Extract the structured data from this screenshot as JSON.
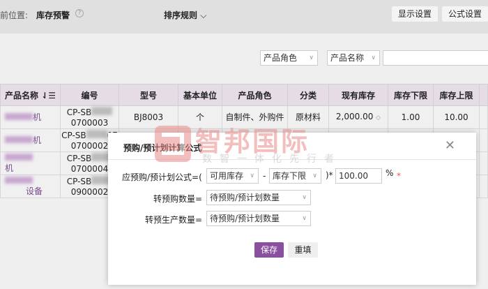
{
  "header": {
    "location_label": "前位置:",
    "location": "库存预警",
    "help_icon": "question-circle-icon",
    "sort_label": "排序规则",
    "display_settings": "显示设置",
    "formula_settings": "公式设置"
  },
  "filters": {
    "role_select": "产品角色",
    "name_select": "产品名称",
    "search_value": ""
  },
  "table": {
    "columns": [
      "产品名称",
      "编号",
      "型号",
      "基本单位",
      "产品角色",
      "分类",
      "现有库存",
      "库存下限",
      "库存上限"
    ],
    "rows": [
      {
        "name_suffix": "机",
        "code_prefix": "CP-SB",
        "code_suffix": "0700003",
        "model": "BJ8003",
        "unit": "个",
        "role": "自制件、外购件",
        "category": "原材料",
        "stock": "2,000.00",
        "min": "1.00",
        "max": "10.00"
      },
      {
        "name_suffix": "机",
        "code_prefix": "CP-SB",
        "code_tail": "07",
        "code_suffix": "0700002"
      },
      {
        "name_suffix": "机",
        "code_prefix": "CP-SB",
        "code_suffix": "0700004"
      },
      {
        "name_suffix": "设备",
        "code_prefix": "CP-SB",
        "code_suffix": "0900002"
      }
    ]
  },
  "dialog": {
    "title": "预购/预计划计算公式",
    "formula_label": "应预购/预计划公式=(",
    "operand1": "可用库存",
    "minus": "-",
    "operand2": "库存下限",
    "times": ")*",
    "percent_value": "100.00",
    "percent": "%",
    "required": "*",
    "purchase_label": "转预购数量=",
    "purchase_value": "待预购/预计划数量",
    "production_label": "转预生产数量=",
    "production_value": "待预购/预计划数量",
    "save": "保存",
    "reset": "重填"
  },
  "watermark": {
    "brand": "智邦国际",
    "slogan": "数智一体化先行者"
  },
  "colors": {
    "accent": "#8b4f9f",
    "header_bg": "#e5dce6",
    "watermark": "#e88a8a"
  }
}
